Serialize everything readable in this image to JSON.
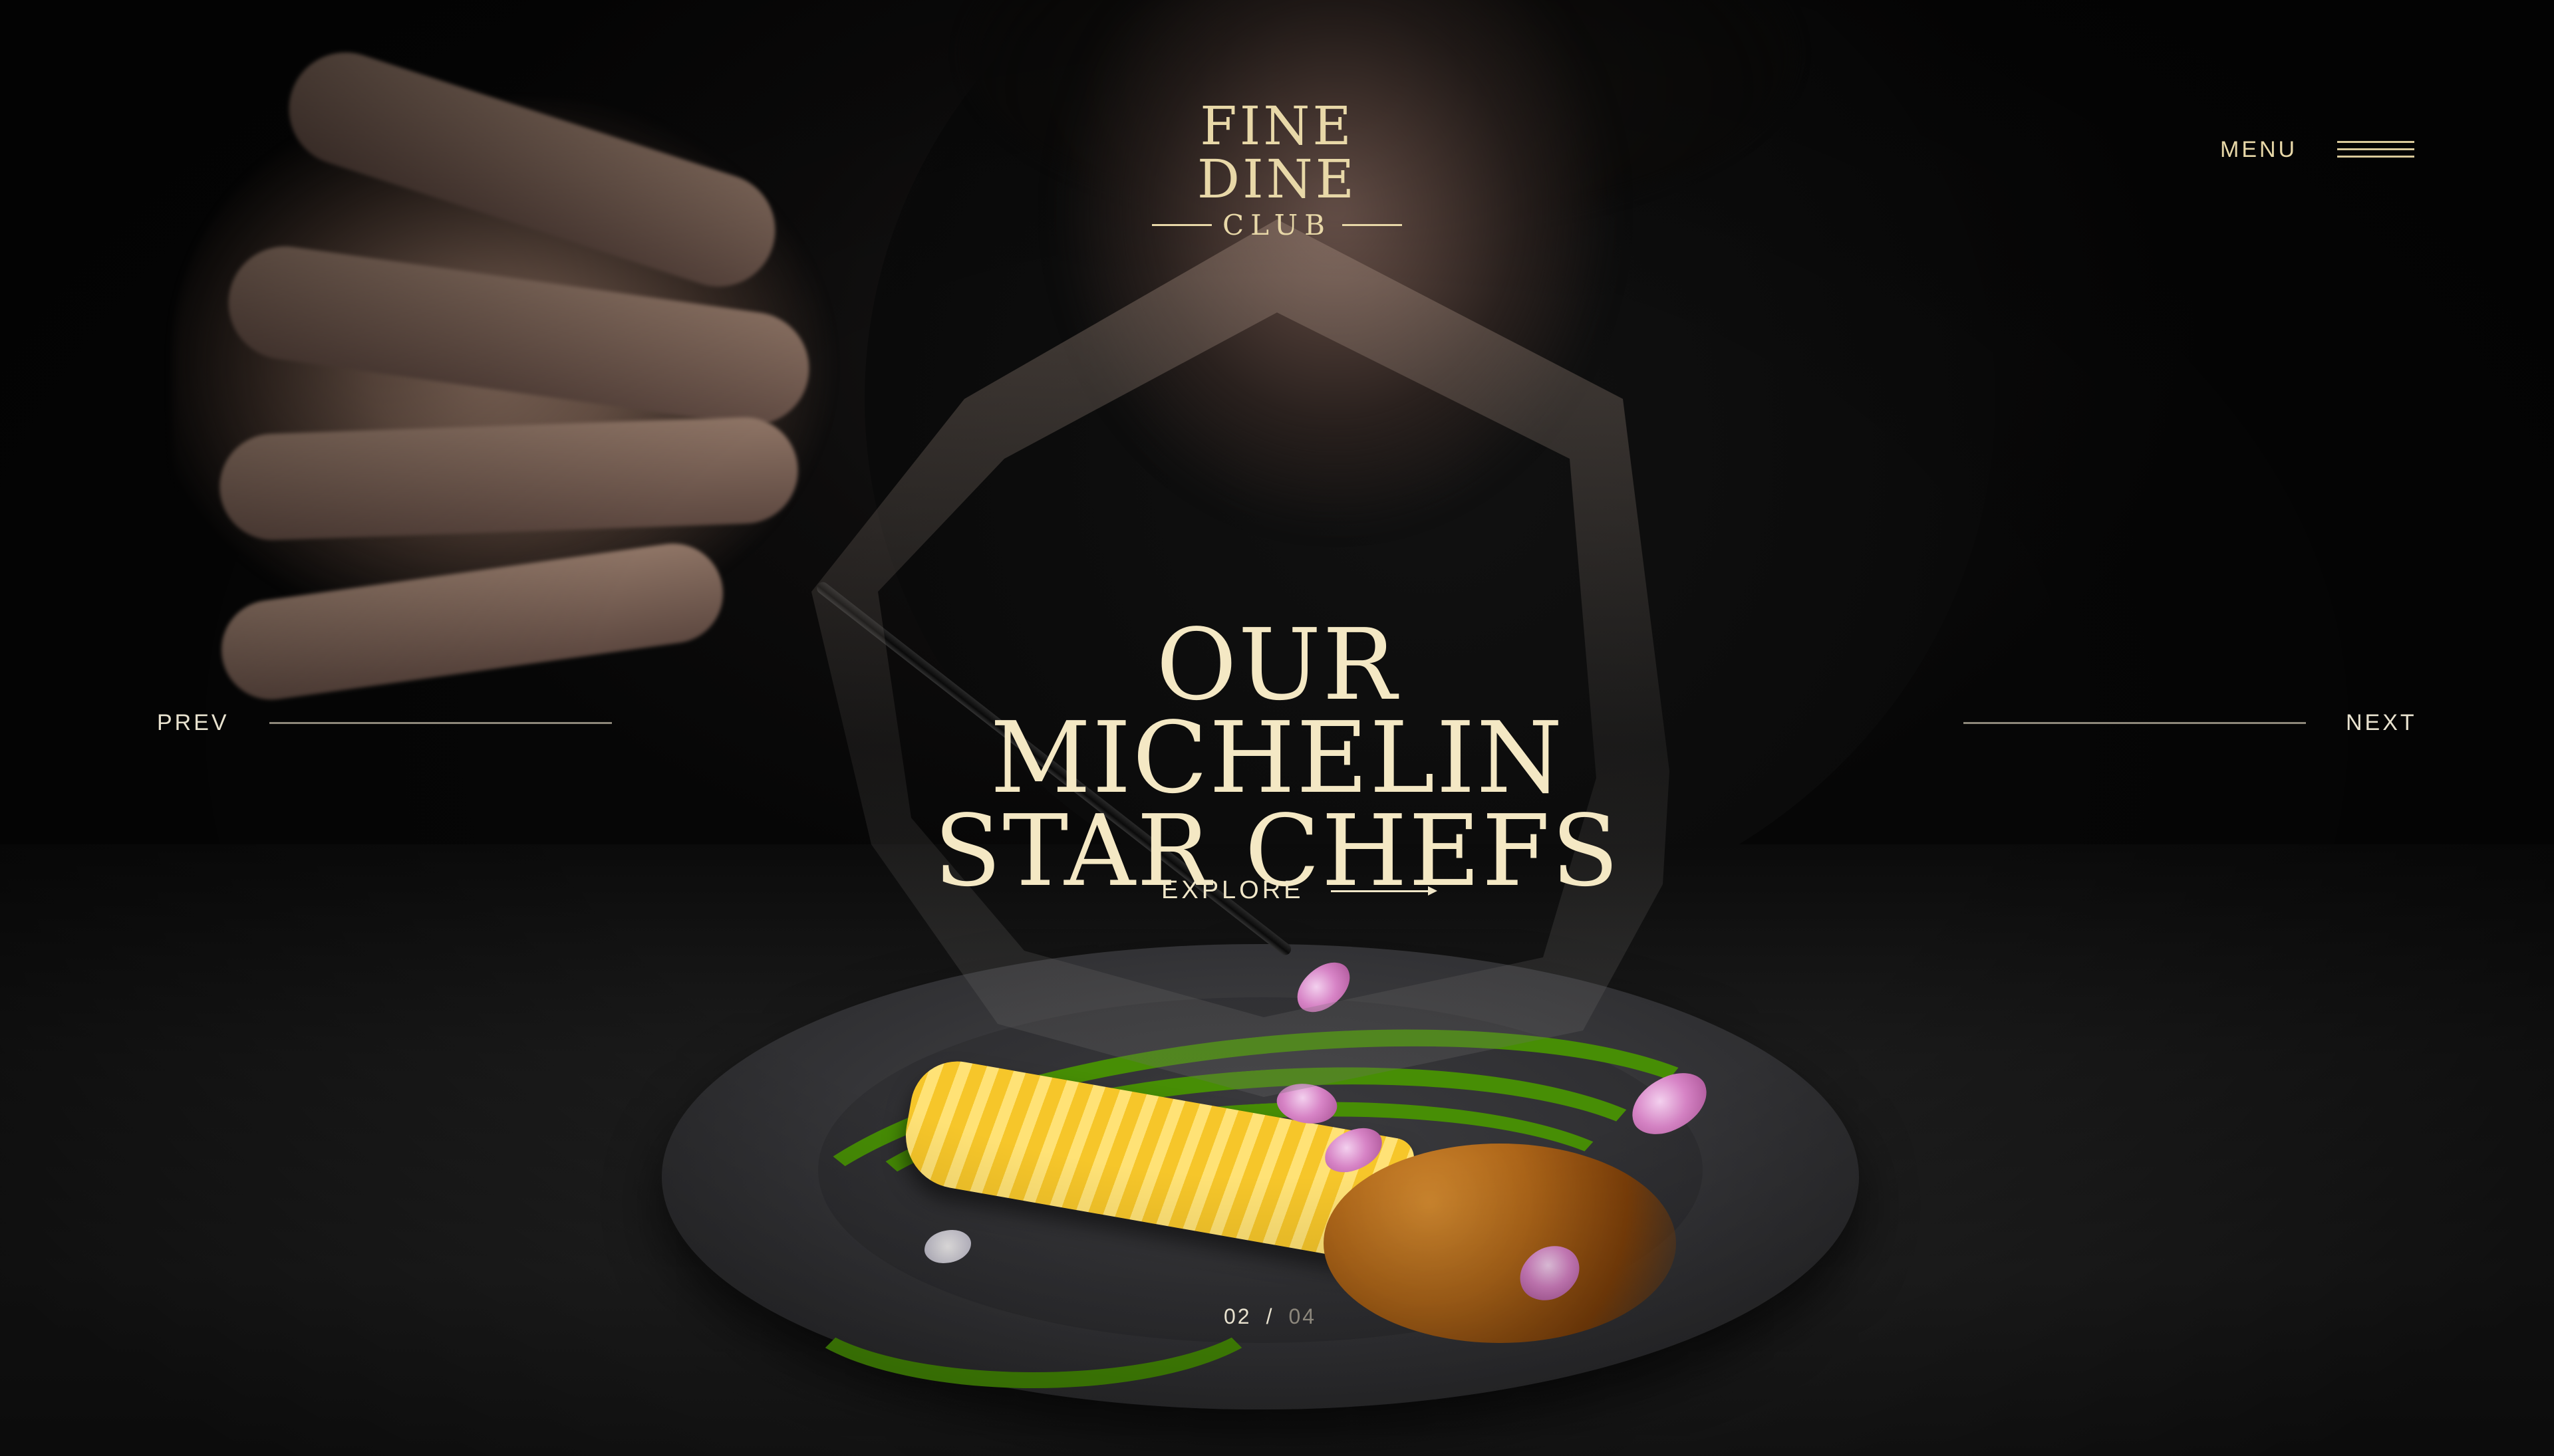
{
  "header": {
    "logo_main": "FINE DINE",
    "logo_sub": "CLUB",
    "menu_label": "MENU"
  },
  "hero": {
    "headline_line1": "OUR MICHELIN",
    "headline_line2": "STAR CHEFS",
    "explore_label": "EXPLORE"
  },
  "nav": {
    "prev_label": "PREV",
    "next_label": "NEXT"
  },
  "pager": {
    "current": "02",
    "separator": "/",
    "total": "04"
  },
  "colors": {
    "accent_gold": "#e8d8a8",
    "headline_cream": "#f4e8c4",
    "background": "#0a0a0a"
  },
  "icons": {
    "menu": "hamburger-icon",
    "explore": "arrow-right-icon"
  }
}
